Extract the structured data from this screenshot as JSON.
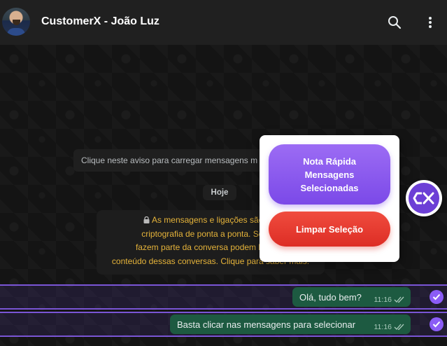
{
  "header": {
    "title": "CustomerX - João Luz",
    "icons": [
      "search-icon",
      "more-vertical-icon"
    ]
  },
  "chat": {
    "load_notice": "Clique neste aviso para carregar mensagens m",
    "date_label": "Hoje",
    "encryption_notice": {
      "lines": [
        "As mensagens e ligações são pro",
        "criptografia de ponta a ponta. Somen",
        "fazem parte da conversa podem ler, ouv",
        "conteúdo dessas conversas. Clique para saber mais."
      ]
    },
    "messages": [
      {
        "text": "Olá, tudo bem?",
        "time": "11:16",
        "selected": true
      },
      {
        "text": "Basta clicar nas mensagens para selecionar",
        "time": "11:16",
        "selected": true
      }
    ]
  },
  "popup": {
    "quick_note_label": "Nota Rápida Mensagens Selecionadas",
    "clear_label": "Limpar Seleção"
  },
  "badge": {
    "label": "CX"
  },
  "colors": {
    "accent": "#7b49e8",
    "danger": "#dd2d25",
    "bubble": "#1d5a41",
    "selection": "#7a55d6",
    "warning_text": "#e5b33a"
  }
}
